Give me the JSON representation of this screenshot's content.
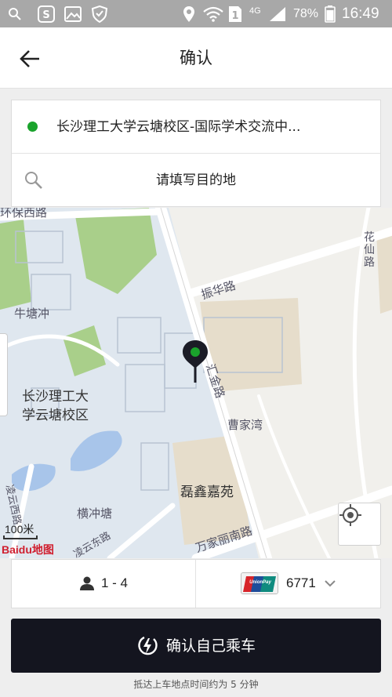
{
  "status_bar": {
    "network": "4G",
    "battery": "78%",
    "time": "16:49",
    "icons": [
      "search-icon",
      "app-s-icon",
      "image-icon",
      "shield-icon",
      "location-icon",
      "wifi-icon",
      "sim-1-icon",
      "signal-icon",
      "battery-icon"
    ]
  },
  "header": {
    "title": "确认",
    "back_icon": "arrow-left-icon"
  },
  "trip": {
    "origin": "长沙理工大学云塘校区-国际学术交流中...",
    "destination_placeholder": "请填写目的地",
    "origin_dot_color": "#1aa32c"
  },
  "map": {
    "labels": {
      "road_top": "环保西路",
      "area_niutang": "牛塘冲",
      "road_zhenhua": "振华路",
      "road_huajin": "汇金路",
      "area_campus_line1": "长沙理工大",
      "area_campus_line2": "学云塘校区",
      "area_caojiawan": "曹家湾",
      "area_leixin": "磊鑫嘉苑",
      "area_hengchong": "横冲塘",
      "road_lingyunxi": "凌云西路",
      "road_lingyundong": "凌云东路",
      "road_wanjiali": "万家丽南路",
      "road_huaxian": "花仙路"
    },
    "scale": "100米",
    "logo": "Baidu地图",
    "locate_icon": "locate-target-icon"
  },
  "options": {
    "passengers": "1 - 4",
    "card_number": "6771",
    "card_logo_text": "UnionPay 银联"
  },
  "confirm": {
    "label": "确认自己乘车"
  },
  "note": "抵达上车地点时间约为 5 分钟"
}
